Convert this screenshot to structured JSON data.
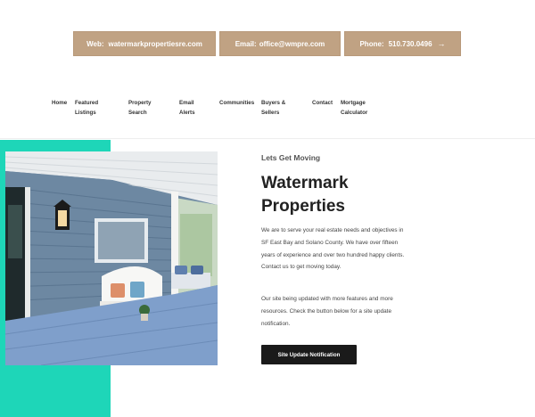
{
  "contact_bar": {
    "web_label": "Web:",
    "web_value": "watermarkpropertiesre.com",
    "email_label": "Email:",
    "email_value": "office@wmpre.com",
    "phone_label": "Phone:",
    "phone_value": "510.730.0496",
    "phone_icon": "arrow-right-icon"
  },
  "nav": {
    "items": [
      {
        "line1": "Home",
        "line2": ""
      },
      {
        "line1": "Featured",
        "line2": "Listings"
      },
      {
        "line1": "Property",
        "line2": "Search"
      },
      {
        "line1": "Email",
        "line2": "Alerts"
      },
      {
        "line1": "Communities",
        "line2": ""
      },
      {
        "line1": "Buyers &",
        "line2": "Sellers"
      },
      {
        "line1": "Contact",
        "line2": ""
      },
      {
        "line1": "Mortgage",
        "line2": "Calculator"
      }
    ]
  },
  "hero": {
    "eyebrow": "Lets Get Moving",
    "title_line1": "Watermark",
    "title_line2": "Properties",
    "paragraph1": "We are to serve your real estate needs and objectives in SF East Bay and Solano County. We have over fifteen years of experience and over two hundred happy clients. Contact us to get moving today.",
    "paragraph2": "Our site being updated with more features and more resources. Check the button below for a site update notification.",
    "cta_label": "Site Update Notification"
  },
  "colors": {
    "accent_tan": "#c0a283",
    "teal": "#1ed6b8",
    "cta_dark": "#1a1a1a"
  }
}
